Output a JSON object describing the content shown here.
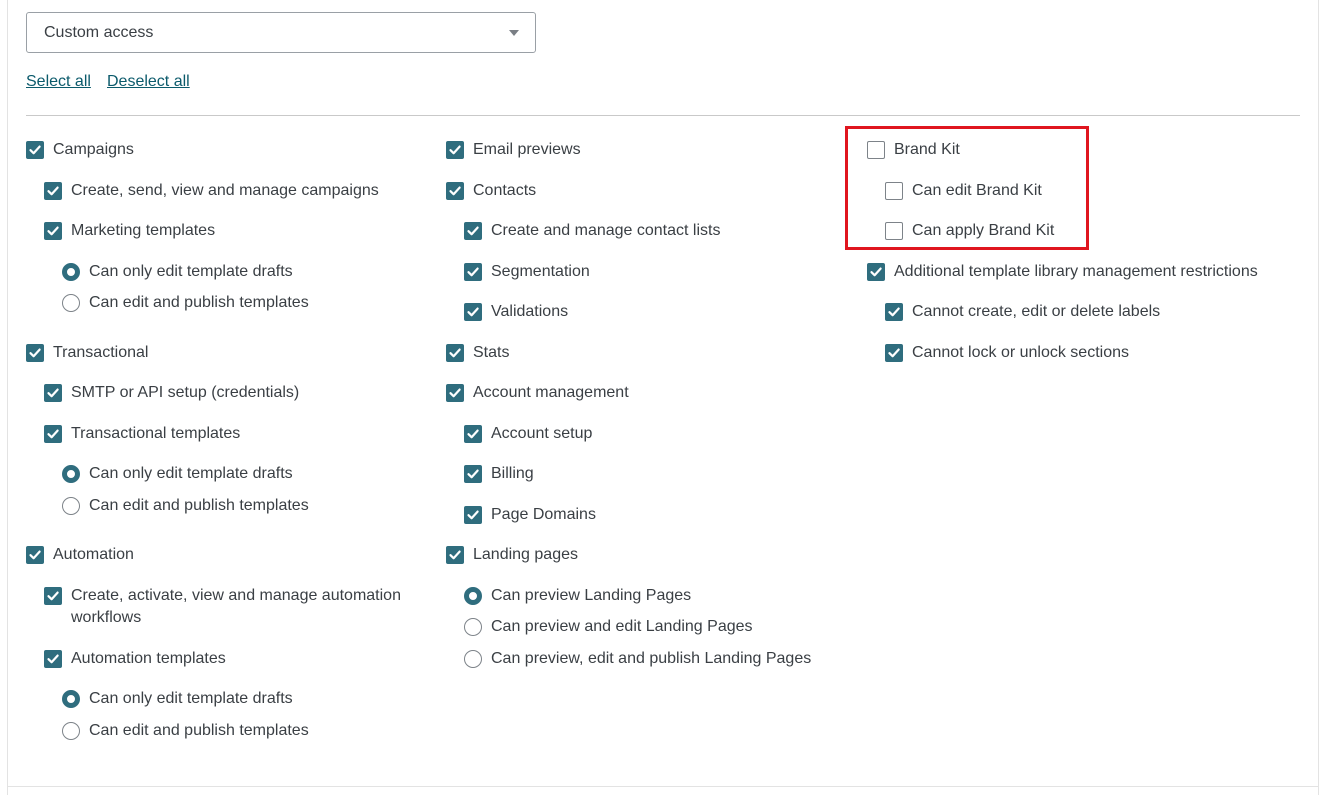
{
  "access_select": {
    "value": "Custom access"
  },
  "links": {
    "select_all": "Select all",
    "deselect_all": "Deselect all"
  },
  "colors": {
    "accent": "#2f6d7e",
    "link": "#0b5a6b",
    "highlight": "#e0161f"
  },
  "column1": {
    "campaigns": {
      "label": "Campaigns",
      "checked": true,
      "create": {
        "label": "Create, send, view and manage campaigns",
        "checked": true
      },
      "templates": {
        "label": "Marketing templates",
        "checked": true
      },
      "opt_drafts": {
        "label": "Can only edit template drafts",
        "selected": true
      },
      "opt_publish": {
        "label": "Can edit and publish templates",
        "selected": false
      }
    },
    "transactional": {
      "label": "Transactional",
      "checked": true,
      "smtp": {
        "label": "SMTP or API setup (credentials)",
        "checked": true
      },
      "templates": {
        "label": "Transactional templates",
        "checked": true
      },
      "opt_drafts": {
        "label": "Can only edit template drafts",
        "selected": true
      },
      "opt_publish": {
        "label": "Can edit and publish templates",
        "selected": false
      }
    },
    "automation": {
      "label": "Automation",
      "checked": true,
      "workflows": {
        "label_line1": "Create, activate, view and manage automation",
        "label_line2": "workflows",
        "checked": true
      },
      "templates": {
        "label": "Automation templates",
        "checked": true
      },
      "opt_drafts": {
        "label": "Can only edit template drafts",
        "selected": true
      },
      "opt_publish": {
        "label": "Can edit and publish templates",
        "selected": false
      }
    }
  },
  "column2": {
    "email_previews": {
      "label": "Email previews",
      "checked": true
    },
    "contacts": {
      "label": "Contacts",
      "checked": true,
      "lists": {
        "label": "Create and manage contact lists",
        "checked": true
      },
      "segmentation": {
        "label": "Segmentation",
        "checked": true
      },
      "validations": {
        "label": "Validations",
        "checked": true
      }
    },
    "stats": {
      "label": "Stats",
      "checked": true
    },
    "account": {
      "label": "Account management",
      "checked": true,
      "setup": {
        "label": "Account setup",
        "checked": true
      },
      "billing": {
        "label": "Billing",
        "checked": true
      },
      "domains": {
        "label": "Page Domains",
        "checked": true
      }
    },
    "landing": {
      "label": "Landing pages",
      "checked": true,
      "opt_preview": {
        "label": "Can preview Landing Pages",
        "selected": true
      },
      "opt_edit": {
        "label": "Can preview and edit Landing Pages",
        "selected": false
      },
      "opt_publish": {
        "label": "Can preview, edit and publish Landing Pages",
        "selected": false
      }
    }
  },
  "column3": {
    "brand_kit": {
      "label": "Brand Kit",
      "checked": false,
      "edit": {
        "label": "Can edit Brand Kit",
        "checked": false
      },
      "apply": {
        "label": "Can apply Brand Kit",
        "checked": false
      }
    },
    "library": {
      "label": "Additional template library management restrictions",
      "checked": true,
      "labels": {
        "label": "Cannot create, edit or delete labels",
        "checked": true
      },
      "sections": {
        "label": "Cannot lock or unlock sections",
        "checked": true
      }
    }
  }
}
